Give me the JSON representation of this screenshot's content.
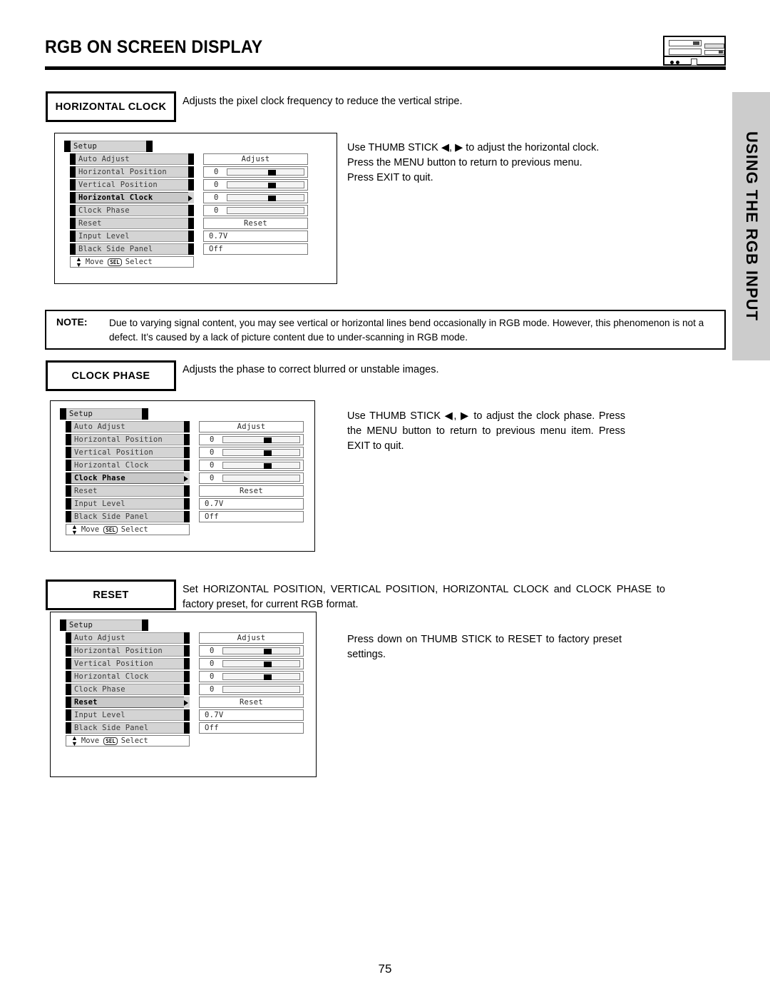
{
  "header": {
    "title": "RGB ON SCREEN DISPLAY",
    "tv_icon": "tv-front-panel-icon"
  },
  "side_tab": {
    "label": "USING THE RGB INPUT"
  },
  "sections": [
    {
      "label": "HORIZONTAL CLOCK",
      "description": "Adjusts the pixel clock frequency to reduce the vertical stripe.",
      "instruction": "Use THUMB STICK ◀, ▶ to adjust the horizontal clock.  Press the MENU button to return to previous menu.  Press EXIT to quit."
    },
    {
      "label": "CLOCK PHASE",
      "description": "Adjusts the phase to correct blurred or unstable images.",
      "instruction": "Use  THUMB STICK ◀,  ▶  to  adjust  the  clock  phase. Press the MENU button to return to previous menu item. Press EXIT to quit."
    },
    {
      "label": "RESET",
      "description": "Set  HORIZONTAL  POSITION,  VERTICAL  POSITION,  HORIZONTAL  CLOCK   and  CLOCK PHASE to factory preset, for current RGB format.",
      "instruction": "Press  down  on  THUMB STICK  to  RESET  to  factory preset settings."
    }
  ],
  "note": {
    "label": "NOTE:",
    "text": "Due to varying signal content, you may see vertical or horizontal lines bend occasionally in RGB mode.  However, this phenomenon is not a defect.  It’s caused by a lack of picture content due to under-scanning in RGB mode."
  },
  "osd": {
    "title": "Setup",
    "footer": {
      "move": "Move",
      "sel_key": "SEL",
      "select": "Select"
    },
    "menus": [
      {
        "name": "horizontal-clock-menu",
        "selected": "Horizontal Clock",
        "rows": [
          {
            "label": "Auto Adjust",
            "type": "text",
            "value": "Adjust"
          },
          {
            "label": "Horizontal Position",
            "type": "slider",
            "value": "0",
            "pos": 53
          },
          {
            "label": "Vertical Position",
            "type": "slider",
            "value": "0",
            "pos": 53
          },
          {
            "label": "Horizontal Clock",
            "type": "slider",
            "value": "0",
            "pos": 53
          },
          {
            "label": "Clock Phase",
            "type": "slider",
            "value": "0",
            "pos": null
          },
          {
            "label": "Reset",
            "type": "text",
            "value": "Reset"
          },
          {
            "label": "Input Level",
            "type": "left",
            "value": "0.7V"
          },
          {
            "label": "Black Side Panel",
            "type": "left",
            "value": "Off"
          }
        ]
      },
      {
        "name": "clock-phase-menu",
        "selected": "Clock Phase",
        "rows": [
          {
            "label": "Auto Adjust",
            "type": "text",
            "value": "Adjust"
          },
          {
            "label": "Horizontal Position",
            "type": "slider",
            "value": "0",
            "pos": 53
          },
          {
            "label": "Vertical Position",
            "type": "slider",
            "value": "0",
            "pos": 53
          },
          {
            "label": "Horizontal Clock",
            "type": "slider",
            "value": "0",
            "pos": 53
          },
          {
            "label": "Clock Phase",
            "type": "slider",
            "value": "0",
            "pos": null
          },
          {
            "label": "Reset",
            "type": "text",
            "value": "Reset"
          },
          {
            "label": "Input Level",
            "type": "left",
            "value": "0.7V"
          },
          {
            "label": "Black Side Panel",
            "type": "left",
            "value": "Off"
          }
        ]
      },
      {
        "name": "reset-menu",
        "selected": "Reset",
        "rows": [
          {
            "label": "Auto Adjust",
            "type": "text",
            "value": "Adjust"
          },
          {
            "label": "Horizontal Position",
            "type": "slider",
            "value": "0",
            "pos": 53
          },
          {
            "label": "Vertical Position",
            "type": "slider",
            "value": "0",
            "pos": 53
          },
          {
            "label": "Horizontal Clock",
            "type": "slider",
            "value": "0",
            "pos": 53
          },
          {
            "label": "Clock Phase",
            "type": "slider",
            "value": "0",
            "pos": null
          },
          {
            "label": "Reset",
            "type": "text",
            "value": "Reset"
          },
          {
            "label": "Input Level",
            "type": "left",
            "value": "0.7V"
          },
          {
            "label": "Black Side Panel",
            "type": "left",
            "value": "Off"
          }
        ]
      }
    ]
  },
  "page_number": "75",
  "colors": {
    "side_tab_bg": "#cccccc",
    "osd_item_bg": "#d4d4d4",
    "osd_selected_bg": "#c9c9c9",
    "ink": "#000000"
  }
}
